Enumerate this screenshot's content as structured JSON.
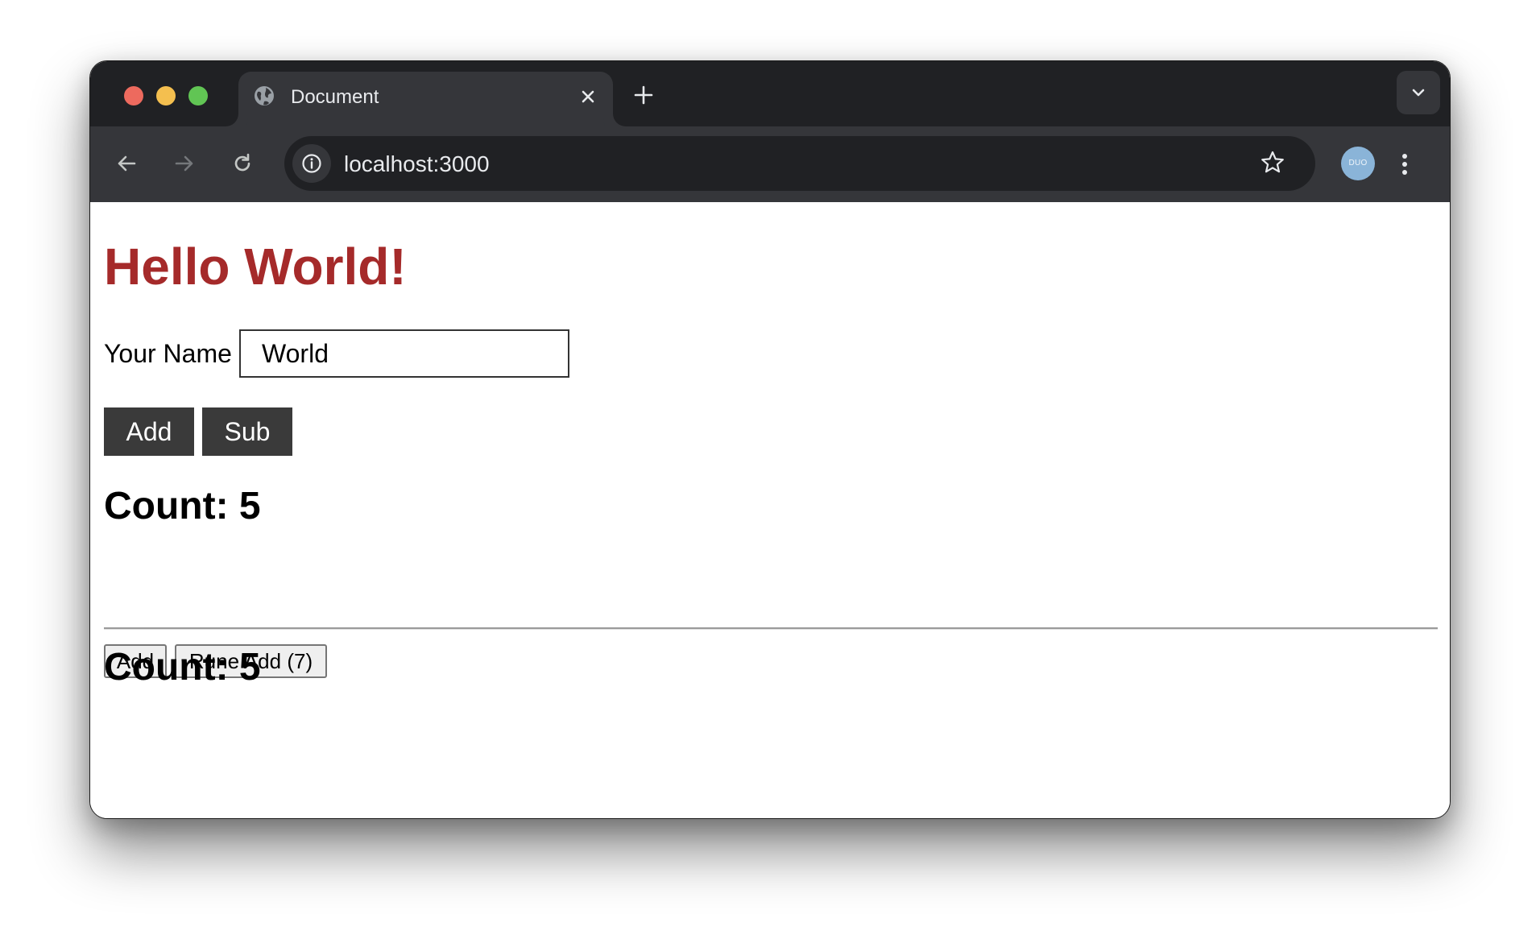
{
  "browser": {
    "tab": {
      "title": "Document",
      "favicon": "globe-icon"
    },
    "address_bar": {
      "url": "localhost:3000"
    },
    "profile": {
      "avatar_text": "DUO",
      "avatar_color": "#8ab4d8"
    },
    "colors": {
      "tabstrip": "#202124",
      "toolbar": "#35363a",
      "omnibox": "#202124"
    }
  },
  "page": {
    "heading": "Hello World!",
    "heading_color": "#a52a2a",
    "name_field": {
      "label": "Your Name",
      "value": "World"
    },
    "styled_buttons": {
      "add_label": "Add",
      "sub_label": "Sub",
      "color": "#3a3a3a"
    },
    "count_1": "Count: 5",
    "plain_buttons": {
      "add_label": "Add",
      "rune_add_label": "Rune Add (7)"
    },
    "count_2": "Count: 5"
  }
}
